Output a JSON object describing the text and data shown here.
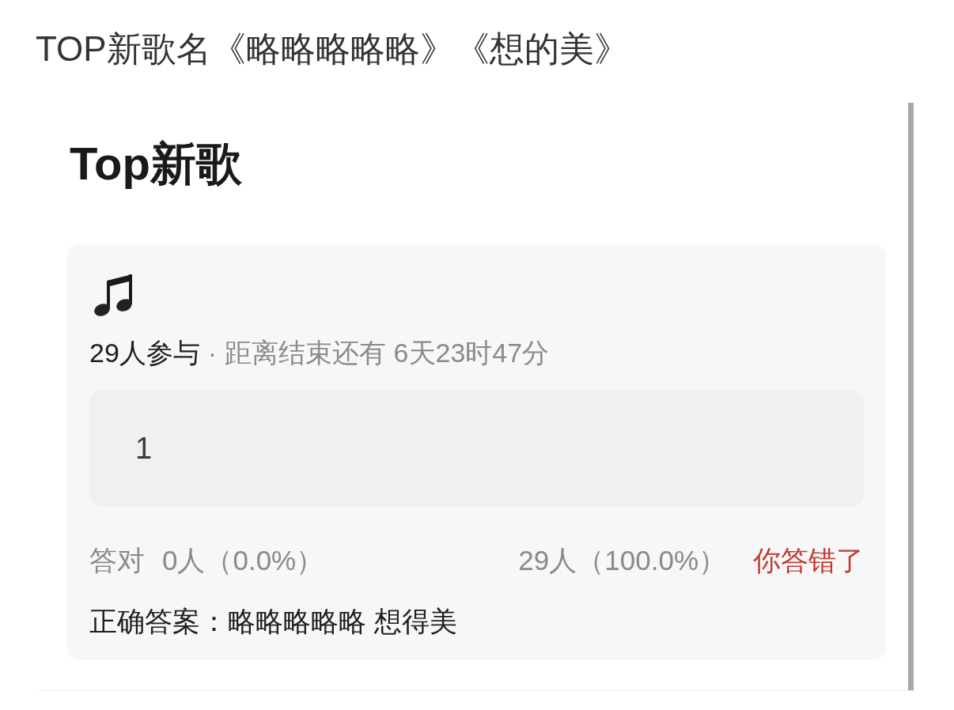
{
  "caption": "TOP新歌名《略略略略略》《想的美》",
  "quiz": {
    "title": "Top新歌",
    "participants": "29人参与",
    "separator": "·",
    "countdown": "距离结束还有 6天23时47分",
    "answer": {
      "value": "1"
    },
    "stats": {
      "correct_label": "答对",
      "correct_value": "0人（0.0%）",
      "wrong_value": "29人（100.0%）"
    },
    "result": {
      "text": "你答错了",
      "correct": false
    },
    "correct_answer": "正确答案：略略略略略 想得美"
  }
}
